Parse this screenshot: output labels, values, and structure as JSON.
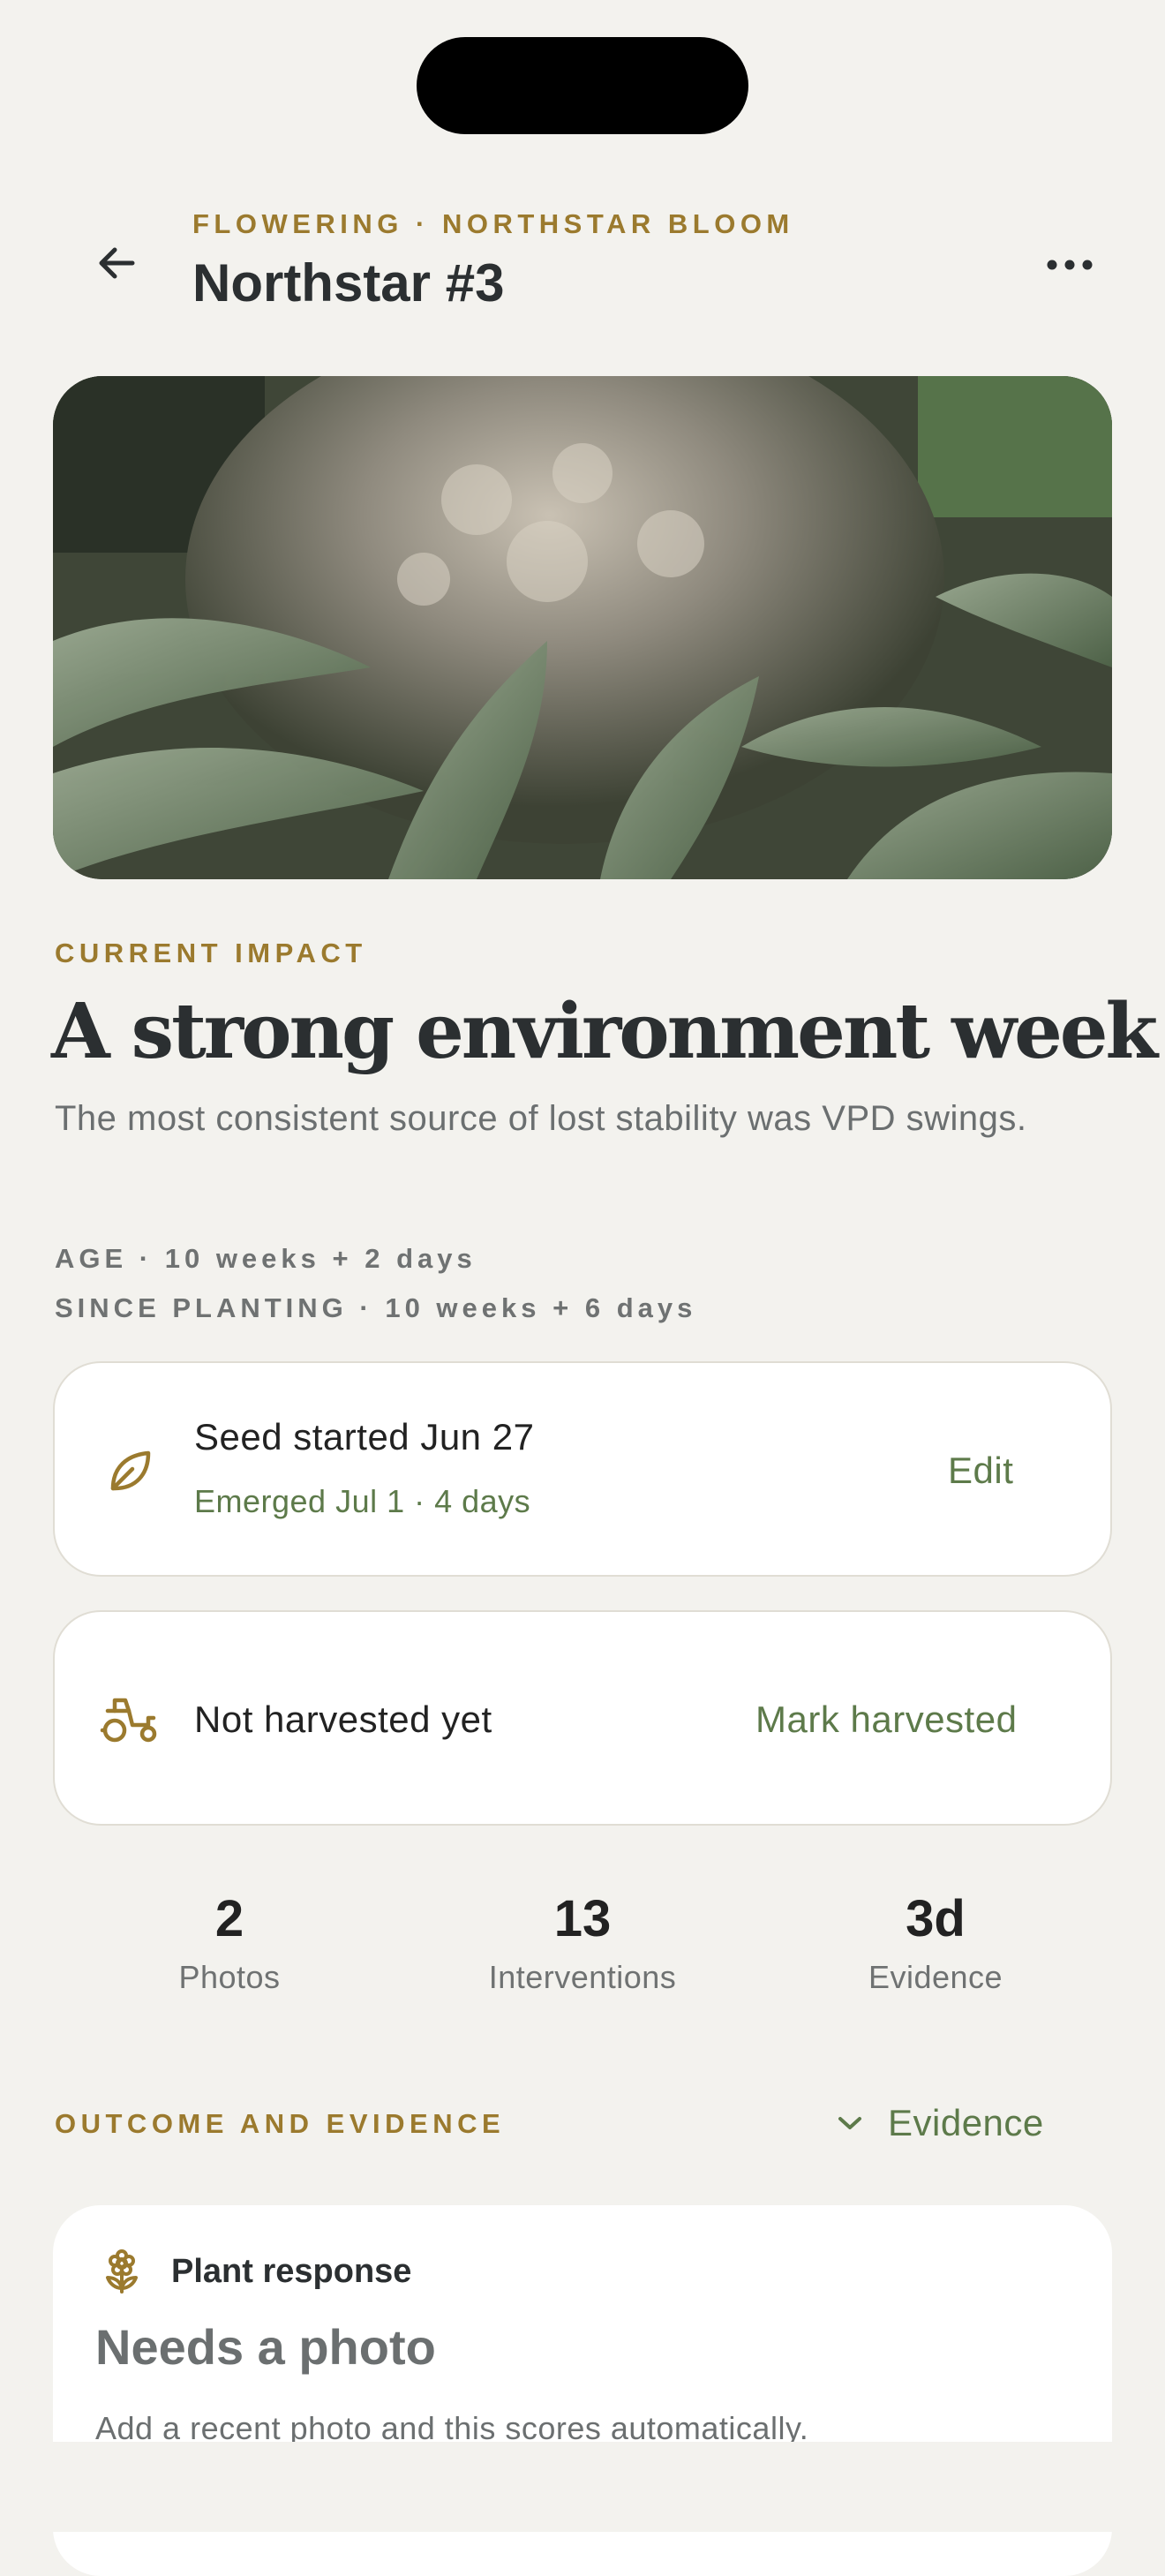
{
  "header": {
    "eyebrow": "FLOWERING · NORTHSTAR BLOOM",
    "title": "Northstar #3"
  },
  "hero": {
    "alt": "plant photo"
  },
  "impact": {
    "label": "CURRENT IMPACT",
    "headline": "A strong environment week",
    "description": "The most consistent source of lost stability was VPD swings.",
    "age": "AGE · 10 weeks + 2 days",
    "since_planting": "SINCE PLANTING · 10 weeks + 6 days"
  },
  "seed_card": {
    "title": "Seed started Jun 27",
    "subtitle": "Emerged Jul 1 · 4 days",
    "action": "Edit",
    "icon": "leaf-icon"
  },
  "harvest_card": {
    "title": "Not harvested yet",
    "action": "Mark harvested",
    "icon": "tractor-icon"
  },
  "stats": [
    {
      "value": "2",
      "label": "Photos"
    },
    {
      "value": "13",
      "label": "Interventions"
    },
    {
      "value": "3d",
      "label": "Evidence"
    }
  ],
  "outcome": {
    "label": "OUTCOME AND EVIDENCE",
    "toggle_label": "Evidence"
  },
  "response": {
    "title": "Plant response",
    "headline": "Needs a photo",
    "description": "Add a recent photo and this scores automatically.",
    "icon": "flower-icon"
  },
  "colors": {
    "accent_gold": "#9b7a2e",
    "accent_green": "#5d7a4a",
    "background": "#f3f2ee"
  }
}
